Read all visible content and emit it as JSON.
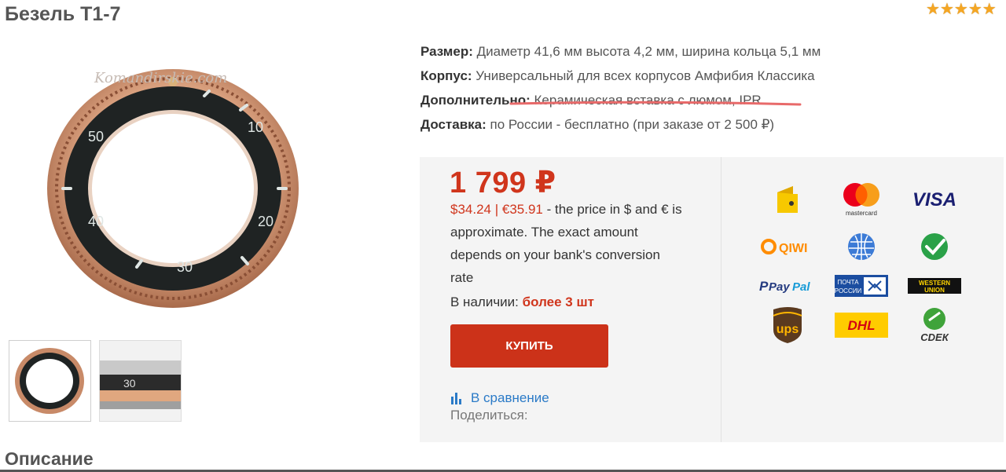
{
  "product": {
    "title": "Безель T1-7",
    "rating_stars": 5,
    "watermark": "Komandirskie.com"
  },
  "specs": [
    {
      "label": "Размер:",
      "value": "Диаметр 41,6 мм высота 4,2 мм, ширина кольца 5,1 мм"
    },
    {
      "label": "Корпус:",
      "value": "Универсальный для всех корпусов Амфибия Классика"
    },
    {
      "label": "Дополнительно:",
      "value": "Керамическая вставка с люмом, IPR"
    },
    {
      "label": "Доставка:",
      "value": "по России - бесплатно (при заказе от 2 500 ₽)"
    }
  ],
  "buy": {
    "price": "1 799 ₽",
    "conversion": "$34.24 | €35.91",
    "approx_note": " - the price in $ and € is approximate. The exact amount depends on your bank's conversion rate",
    "stock_label": "В наличии: ",
    "stock_value": "более 3 шт",
    "buy_button": "КУПИТЬ",
    "compare": "В сравнение",
    "share": "Поделиться:"
  },
  "payment_methods": [
    "yandex-money",
    "mastercard",
    "visa",
    "qiwi",
    "webmoney",
    "sberbank",
    "paypal",
    "pochta-rossii",
    "western-union",
    "ups",
    "dhl",
    "cdek"
  ],
  "payment_labels": {
    "mastercard": "mastercard",
    "visa": "VISA",
    "qiwi": "QIWI",
    "paypal_pay": "Pay",
    "paypal_pal": "Pal",
    "pochta_1": "ПОЧТА",
    "pochta_2": "РОССИИ",
    "wu_1": "WESTERN",
    "wu_2": "UNION",
    "ups": "ups",
    "dhl": "DHL",
    "cdek": "СDЕК"
  },
  "description": {
    "title": "Описание"
  },
  "colors": {
    "accent": "#d0351c",
    "link": "#2a7ac7",
    "box_bg": "#f4f4f4"
  }
}
